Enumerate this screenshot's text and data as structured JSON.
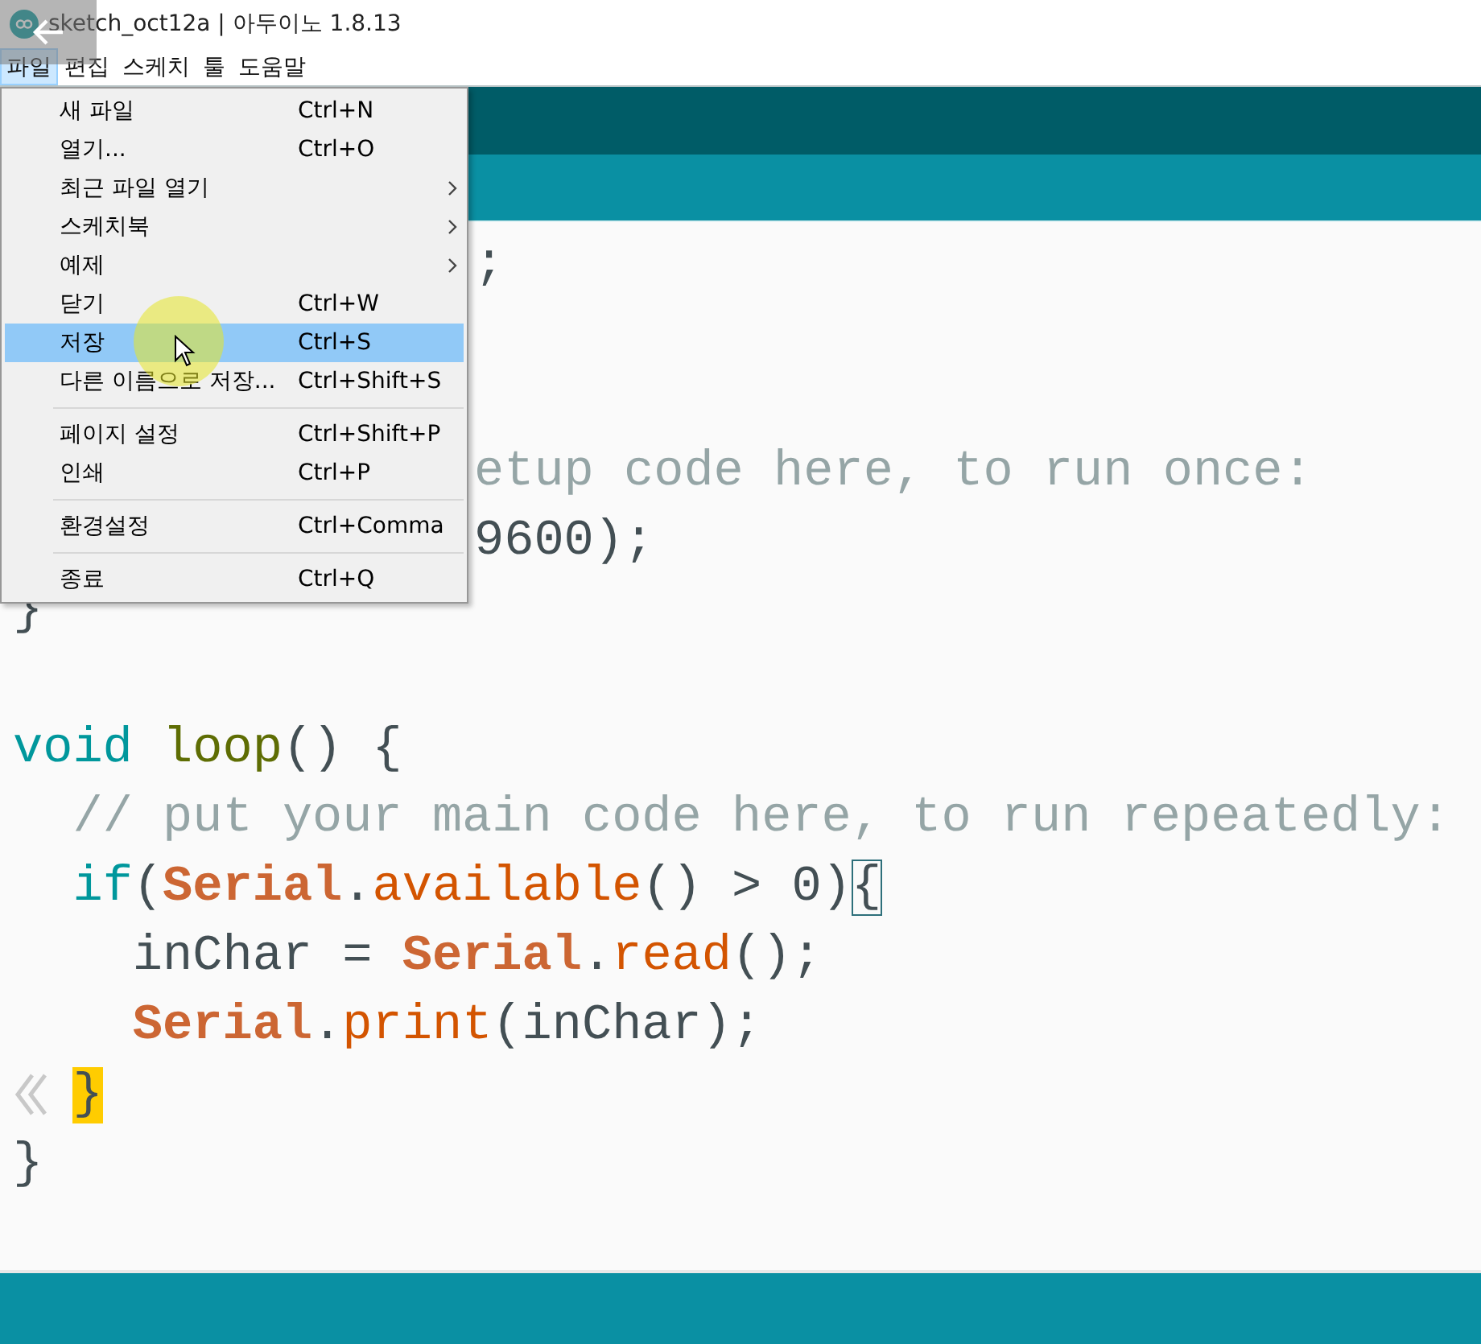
{
  "window": {
    "title": "sketch_oct12a | 아두이노 1.8.13"
  },
  "menu_bar": [
    {
      "label": "파일",
      "selected": true
    },
    {
      "label": "편집",
      "selected": false
    },
    {
      "label": "스케치",
      "selected": false
    },
    {
      "label": "툴",
      "selected": false
    },
    {
      "label": "도움말",
      "selected": false
    }
  ],
  "file_menu": [
    {
      "kind": "item",
      "label": "새 파일",
      "shortcut": "Ctrl+N",
      "submenu": false,
      "selected": false
    },
    {
      "kind": "item",
      "label": "열기...",
      "shortcut": "Ctrl+O",
      "submenu": false,
      "selected": false
    },
    {
      "kind": "item",
      "label": "최근 파일 열기",
      "submenu": true,
      "selected": false
    },
    {
      "kind": "item",
      "label": "스케치북",
      "submenu": true,
      "selected": false
    },
    {
      "kind": "item",
      "label": "예제",
      "submenu": true,
      "selected": false
    },
    {
      "kind": "item",
      "label": "닫기",
      "shortcut": "Ctrl+W",
      "submenu": false,
      "selected": false
    },
    {
      "kind": "item",
      "label": "저장",
      "shortcut": "Ctrl+S",
      "submenu": false,
      "selected": true
    },
    {
      "kind": "item",
      "label": "다른 이름으로 저장...",
      "shortcut": "Ctrl+Shift+S",
      "submenu": false,
      "selected": false
    },
    {
      "kind": "separator"
    },
    {
      "kind": "item",
      "label": "페이지 설정",
      "shortcut": "Ctrl+Shift+P",
      "submenu": false,
      "selected": false
    },
    {
      "kind": "item",
      "label": "인쇄",
      "shortcut": "Ctrl+P",
      "submenu": false,
      "selected": false
    },
    {
      "kind": "separator"
    },
    {
      "kind": "item",
      "label": "환경설정",
      "shortcut": "Ctrl+Comma",
      "submenu": false,
      "selected": false
    },
    {
      "kind": "separator"
    },
    {
      "kind": "item",
      "label": "종료",
      "shortcut": "Ctrl+Q",
      "submenu": false,
      "selected": false
    }
  ],
  "editor": {
    "lines": [
      {
        "kind": "partial",
        "tokens": [
          {
            "kind": "plain",
            "text": ";"
          }
        ]
      },
      {
        "kind": "blank"
      },
      {
        "kind": "blank"
      },
      {
        "kind": "partial",
        "tokens": [
          {
            "kind": "comment",
            "text": "etup code here, to run once:"
          }
        ]
      },
      {
        "kind": "partial",
        "tokens": [
          {
            "kind": "plain",
            "text": "9600);"
          }
        ]
      },
      {
        "kind": "code",
        "tokens": [
          {
            "kind": "plain",
            "text": "}"
          }
        ]
      },
      {
        "kind": "blank"
      },
      {
        "kind": "code",
        "tokens": [
          {
            "kind": "keyword",
            "text": "void"
          },
          {
            "kind": "function",
            "text": " loop"
          },
          {
            "kind": "plain",
            "text": "() {"
          }
        ]
      },
      {
        "kind": "code",
        "tokens": [
          {
            "kind": "comment",
            "text": "  // put your main code here, to run repeatedly:"
          }
        ]
      },
      {
        "kind": "code",
        "tokens": [
          {
            "kind": "keyword",
            "text": "  if"
          },
          {
            "kind": "plain",
            "text": "("
          },
          {
            "kind": "class",
            "text": "Serial"
          },
          {
            "kind": "plain",
            "text": "."
          },
          {
            "kind": "method",
            "text": "available"
          },
          {
            "kind": "plain",
            "text": "() > 0)"
          },
          {
            "kind": "bracket-box",
            "text": "{"
          }
        ]
      },
      {
        "kind": "code",
        "tokens": [
          {
            "kind": "plain",
            "text": "    inChar = "
          },
          {
            "kind": "class",
            "text": "Serial"
          },
          {
            "kind": "plain",
            "text": "."
          },
          {
            "kind": "method",
            "text": "read"
          },
          {
            "kind": "plain",
            "text": "();"
          }
        ]
      },
      {
        "kind": "code",
        "tokens": [
          {
            "kind": "class",
            "text": "    Serial"
          },
          {
            "kind": "plain",
            "text": "."
          },
          {
            "kind": "method",
            "text": "print"
          },
          {
            "kind": "plain",
            "text": "(inChar);"
          }
        ]
      },
      {
        "kind": "code",
        "tokens": [
          {
            "kind": "bracket-highlight",
            "text": "  }"
          }
        ]
      },
      {
        "kind": "code",
        "tokens": [
          {
            "kind": "plain",
            "text": "}"
          }
        ]
      }
    ]
  }
}
